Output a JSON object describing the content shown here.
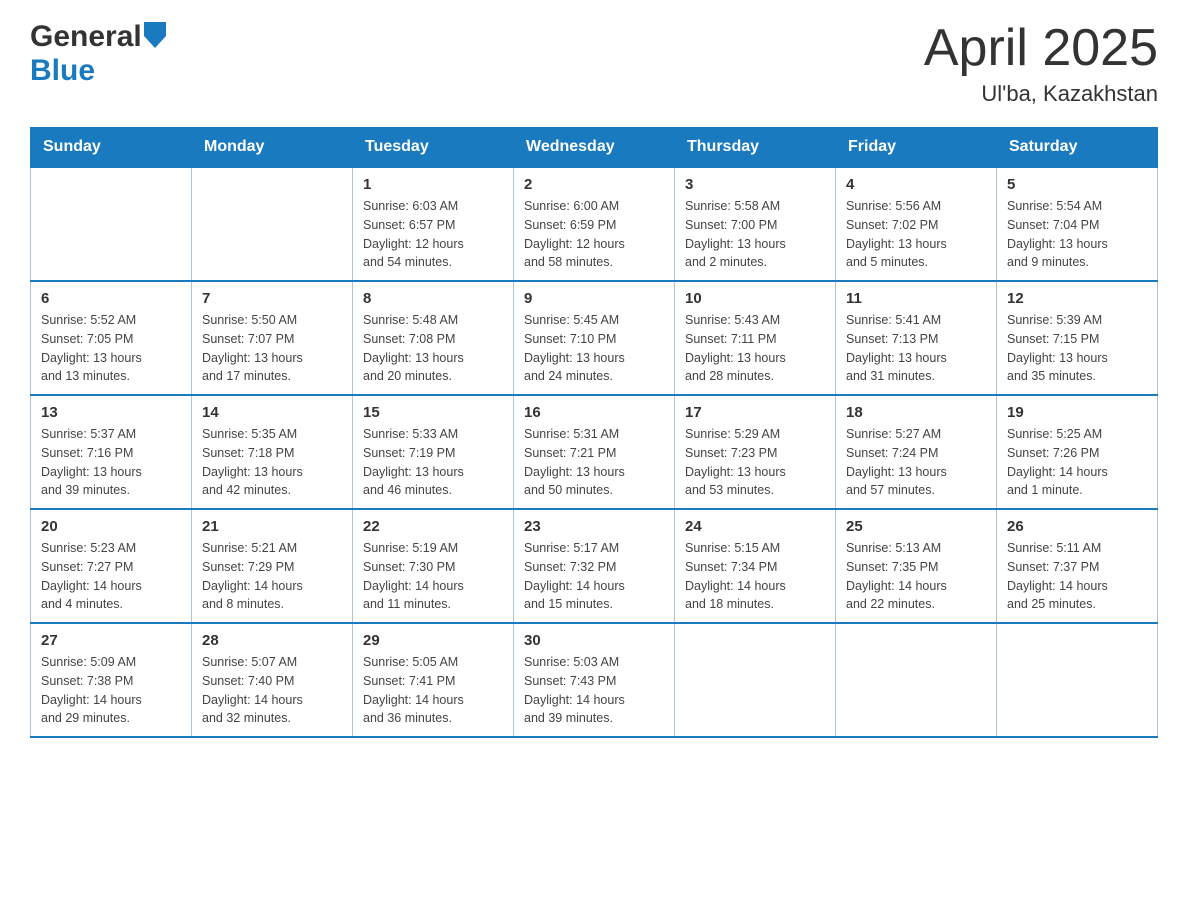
{
  "header": {
    "title": "April 2025",
    "subtitle": "Ul'ba, Kazakhstan",
    "logo_general": "General",
    "logo_blue": "Blue"
  },
  "weekdays": [
    "Sunday",
    "Monday",
    "Tuesday",
    "Wednesday",
    "Thursday",
    "Friday",
    "Saturday"
  ],
  "weeks": [
    [
      {
        "day": "",
        "info": ""
      },
      {
        "day": "",
        "info": ""
      },
      {
        "day": "1",
        "info": "Sunrise: 6:03 AM\nSunset: 6:57 PM\nDaylight: 12 hours\nand 54 minutes."
      },
      {
        "day": "2",
        "info": "Sunrise: 6:00 AM\nSunset: 6:59 PM\nDaylight: 12 hours\nand 58 minutes."
      },
      {
        "day": "3",
        "info": "Sunrise: 5:58 AM\nSunset: 7:00 PM\nDaylight: 13 hours\nand 2 minutes."
      },
      {
        "day": "4",
        "info": "Sunrise: 5:56 AM\nSunset: 7:02 PM\nDaylight: 13 hours\nand 5 minutes."
      },
      {
        "day": "5",
        "info": "Sunrise: 5:54 AM\nSunset: 7:04 PM\nDaylight: 13 hours\nand 9 minutes."
      }
    ],
    [
      {
        "day": "6",
        "info": "Sunrise: 5:52 AM\nSunset: 7:05 PM\nDaylight: 13 hours\nand 13 minutes."
      },
      {
        "day": "7",
        "info": "Sunrise: 5:50 AM\nSunset: 7:07 PM\nDaylight: 13 hours\nand 17 minutes."
      },
      {
        "day": "8",
        "info": "Sunrise: 5:48 AM\nSunset: 7:08 PM\nDaylight: 13 hours\nand 20 minutes."
      },
      {
        "day": "9",
        "info": "Sunrise: 5:45 AM\nSunset: 7:10 PM\nDaylight: 13 hours\nand 24 minutes."
      },
      {
        "day": "10",
        "info": "Sunrise: 5:43 AM\nSunset: 7:11 PM\nDaylight: 13 hours\nand 28 minutes."
      },
      {
        "day": "11",
        "info": "Sunrise: 5:41 AM\nSunset: 7:13 PM\nDaylight: 13 hours\nand 31 minutes."
      },
      {
        "day": "12",
        "info": "Sunrise: 5:39 AM\nSunset: 7:15 PM\nDaylight: 13 hours\nand 35 minutes."
      }
    ],
    [
      {
        "day": "13",
        "info": "Sunrise: 5:37 AM\nSunset: 7:16 PM\nDaylight: 13 hours\nand 39 minutes."
      },
      {
        "day": "14",
        "info": "Sunrise: 5:35 AM\nSunset: 7:18 PM\nDaylight: 13 hours\nand 42 minutes."
      },
      {
        "day": "15",
        "info": "Sunrise: 5:33 AM\nSunset: 7:19 PM\nDaylight: 13 hours\nand 46 minutes."
      },
      {
        "day": "16",
        "info": "Sunrise: 5:31 AM\nSunset: 7:21 PM\nDaylight: 13 hours\nand 50 minutes."
      },
      {
        "day": "17",
        "info": "Sunrise: 5:29 AM\nSunset: 7:23 PM\nDaylight: 13 hours\nand 53 minutes."
      },
      {
        "day": "18",
        "info": "Sunrise: 5:27 AM\nSunset: 7:24 PM\nDaylight: 13 hours\nand 57 minutes."
      },
      {
        "day": "19",
        "info": "Sunrise: 5:25 AM\nSunset: 7:26 PM\nDaylight: 14 hours\nand 1 minute."
      }
    ],
    [
      {
        "day": "20",
        "info": "Sunrise: 5:23 AM\nSunset: 7:27 PM\nDaylight: 14 hours\nand 4 minutes."
      },
      {
        "day": "21",
        "info": "Sunrise: 5:21 AM\nSunset: 7:29 PM\nDaylight: 14 hours\nand 8 minutes."
      },
      {
        "day": "22",
        "info": "Sunrise: 5:19 AM\nSunset: 7:30 PM\nDaylight: 14 hours\nand 11 minutes."
      },
      {
        "day": "23",
        "info": "Sunrise: 5:17 AM\nSunset: 7:32 PM\nDaylight: 14 hours\nand 15 minutes."
      },
      {
        "day": "24",
        "info": "Sunrise: 5:15 AM\nSunset: 7:34 PM\nDaylight: 14 hours\nand 18 minutes."
      },
      {
        "day": "25",
        "info": "Sunrise: 5:13 AM\nSunset: 7:35 PM\nDaylight: 14 hours\nand 22 minutes."
      },
      {
        "day": "26",
        "info": "Sunrise: 5:11 AM\nSunset: 7:37 PM\nDaylight: 14 hours\nand 25 minutes."
      }
    ],
    [
      {
        "day": "27",
        "info": "Sunrise: 5:09 AM\nSunset: 7:38 PM\nDaylight: 14 hours\nand 29 minutes."
      },
      {
        "day": "28",
        "info": "Sunrise: 5:07 AM\nSunset: 7:40 PM\nDaylight: 14 hours\nand 32 minutes."
      },
      {
        "day": "29",
        "info": "Sunrise: 5:05 AM\nSunset: 7:41 PM\nDaylight: 14 hours\nand 36 minutes."
      },
      {
        "day": "30",
        "info": "Sunrise: 5:03 AM\nSunset: 7:43 PM\nDaylight: 14 hours\nand 39 minutes."
      },
      {
        "day": "",
        "info": ""
      },
      {
        "day": "",
        "info": ""
      },
      {
        "day": "",
        "info": ""
      }
    ]
  ]
}
